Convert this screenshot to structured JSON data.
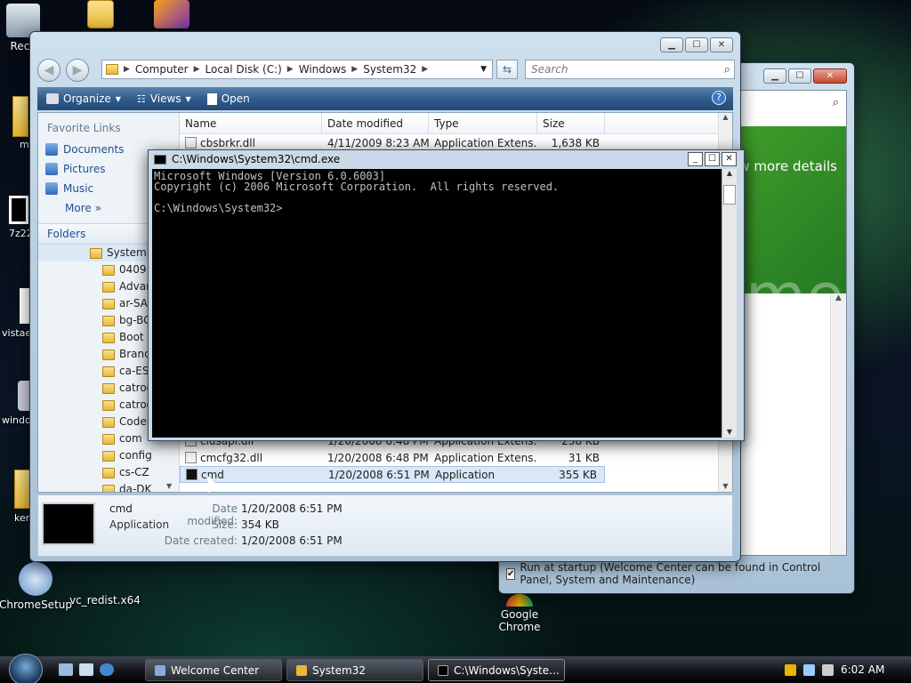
{
  "desktop": {
    "icons": [
      {
        "label": "Recy"
      },
      {
        "label": "m"
      },
      {
        "label": "7z22"
      },
      {
        "label": "vistae"
      },
      {
        "label": "windo"
      },
      {
        "label": "ker"
      },
      {
        "label": "ChromeSetup"
      },
      {
        "label": "vc_redist.x64"
      },
      {
        "label": "Google Chrome"
      }
    ]
  },
  "welcome": {
    "banner_text": "w more details",
    "banner_big": "ome",
    "startup_label": "Run at startup (Welcome Center can be found in Control Panel, System and Maintenance)",
    "startup_checked": "✔"
  },
  "explorer": {
    "breadcrumb": [
      "Computer",
      "Local Disk (C:)",
      "Windows",
      "System32"
    ],
    "search_placeholder": "Search",
    "toolbar": {
      "organize": "Organize",
      "views": "Views",
      "open": "Open"
    },
    "favorite_links_title": "Favorite Links",
    "favorites": [
      "Documents",
      "Pictures",
      "Music"
    ],
    "more": "More",
    "folders_title": "Folders",
    "tree": [
      "System32",
      "0409",
      "Advar",
      "ar-SA",
      "bg-BG",
      "Boot",
      "Branc",
      "ca-ES",
      "catroo",
      "catroo",
      "CodeI",
      "com",
      "config",
      "cs-CZ",
      "da-DK"
    ],
    "columns": {
      "name": "Name",
      "date": "Date modified",
      "type": "Type",
      "size": "Size"
    },
    "files": [
      {
        "name": "cbsbrkr.dll",
        "date": "4/11/2009 8:23 AM",
        "type": "Application Extens...",
        "size": "1,638 KB"
      },
      {
        "name": "clusapi.dll",
        "date": "1/20/2008 6:48 PM",
        "type": "Application Extens...",
        "size": "238 KB"
      },
      {
        "name": "cmcfg32.dll",
        "date": "1/20/2008 6:48 PM",
        "type": "Application Extens...",
        "size": "31 KB"
      },
      {
        "name": "cmd",
        "date": "1/20/2008 6:51 PM",
        "type": "Application",
        "size": "355 KB"
      }
    ],
    "details": {
      "name": "cmd",
      "type": "Application",
      "modified_label": "Date modified:",
      "modified": "1/20/2008 6:51 PM",
      "size_label": "Size:",
      "size": "354 KB",
      "created_label": "Date created:",
      "created": "1/20/2008 6:51 PM"
    }
  },
  "cmd": {
    "title": "C:\\Windows\\System32\\cmd.exe",
    "lines": [
      "Microsoft Windows [Version 6.0.6003]",
      "Copyright (c) 2006 Microsoft Corporation.  All rights reserved.",
      "",
      "C:\\Windows\\System32>"
    ]
  },
  "taskbar": {
    "tasks": [
      "Welcome Center",
      "System32",
      "C:\\Windows\\Syste..."
    ],
    "clock": "6:02 AM"
  },
  "colors": {
    "accent": "#305b8c",
    "cmd_bg": "#000000",
    "banner": "#3e9a2a"
  }
}
